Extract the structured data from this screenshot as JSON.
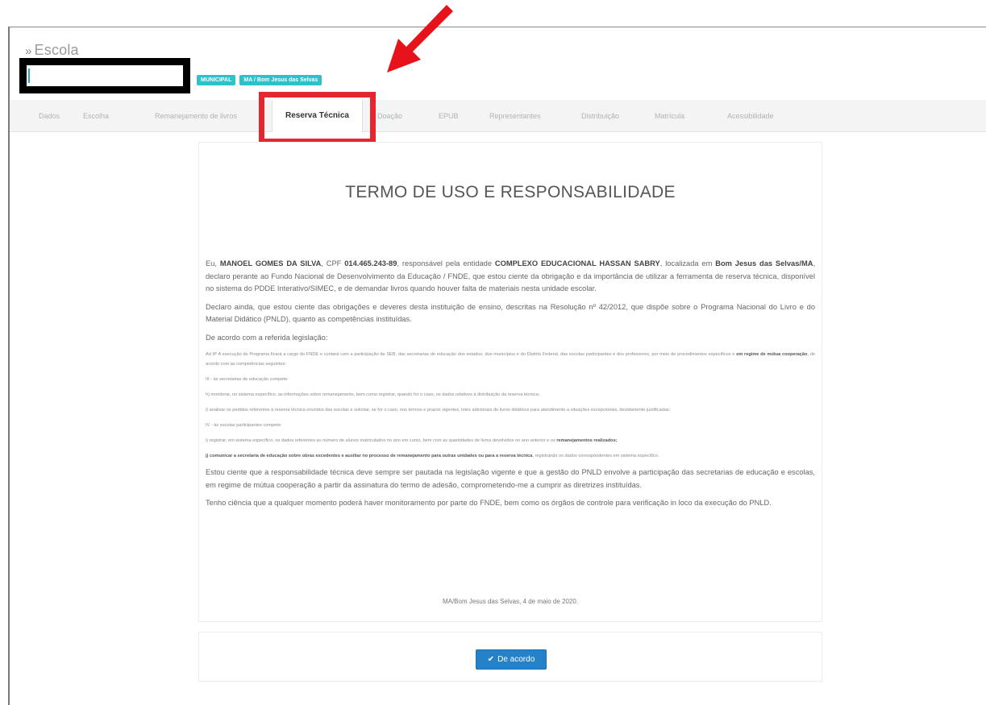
{
  "breadcrumb": {
    "icon": "double-chevron-right-icon",
    "glyph": "»",
    "label": "Escola"
  },
  "badges": [
    "MUNICIPAL",
    "MA / Bom Jesus das Selvas"
  ],
  "tabs": [
    {
      "label": "Dados",
      "active": false
    },
    {
      "label": "Escolha",
      "active": false
    },
    {
      "label": "Remanejamento de livros",
      "active": false
    },
    {
      "label": "Reserva Técnica",
      "active": true
    },
    {
      "label": "Doação",
      "active": false
    },
    {
      "label": "EPUB",
      "active": false
    },
    {
      "label": "Representantes",
      "active": false
    },
    {
      "label": "Distribuição",
      "active": false
    },
    {
      "label": "Matrícula",
      "active": false
    },
    {
      "label": "Acessibilidade",
      "active": false
    }
  ],
  "document": {
    "title": "TERMO DE USO E RESPONSABILIDADE",
    "p1": {
      "t1": "Eu, ",
      "name": "MANOEL GOMES DA SILVA",
      "t2": ", CPF ",
      "cpf": "014.465.243-89",
      "t3": ", responsável pela entidade ",
      "entity": "COMPLEXO EDUCACIONAL HASSAN SABRY",
      "t4": ", localizada em ",
      "location": "Bom Jesus das Selvas/MA",
      "t5": ", declaro perante ao Fundo Nacional de Desenvolvimento da Educação / FNDE, que estou ciente da obrigação e da importância de utilizar a ferramenta de reserva técnica, disponível no sistema do PDDE Interativo/SIMEC, e de demandar livros quando houver falta de materiais nesta unidade escolar."
    },
    "p2": "Declaro ainda, que estou ciente das obrigações e deveres desta instituição de ensino, descritas na Resolução nº 42/2012, que dispõe sobre o Programa Nacional do Livro e do Material Didático (PNLD), quanto as competências instituídas.",
    "p3": "De acordo com a referida legislação:",
    "s1": {
      "t1": "Art 8º A execução do Programa ficará a cargo do FNDE e contará com a participação da SEB, das secretarias de educação dos estados, dos municípios e do Distrito Federal, das escolas participantes e dos professores, por meio de procedimentos específicos e ",
      "bold": "em regime de mútua cooperação",
      "t2": ", de acordo com as competências seguintes:"
    },
    "s2": "III - às secretarias de educação compete:",
    "s3": "h) monitorar, no sistema específico, as informações sobre remanejamento, bem como registrar, quando for o caso, os dados relativos à distribuição da reserva técnica;",
    "s4": "i) analisar os pedidos referentes à reserva técnica oriundos das escolas e solicitar, se for o caso, nos termos e prazos vigentes, lotes adicionais de livros didáticos para atendimento a situações excepcionais, devidamente justificadas;",
    "s5": "IV - às escolas participantes compete:",
    "s6": {
      "t1": "i) registrar, em sistema específico, os dados referentes ao número de alunos matriculados no ano em curso, bem com as quantidades de livros devolvidos no ano anterior e os ",
      "bold": "remanejamentos realizados;"
    },
    "s7": {
      "bold": "j) comunicar a secretaria de educação sobre obras excedentes e auxiliar no processo de remanejamento para outras unidades ou para a reserva técnica",
      "t2": ", registrando os dados correspondentes em sistema específico."
    },
    "p4": "Estou ciente que a responsabilidade técnica deve sempre ser pautada na legislação vigente e que a gestão do PNLD envolve a participação das secretarias de educação e escolas, em regime de mútua cooperação a partir da assinatura do termo de adesão, comprometendo-me a cumprir as diretrizes instituídas.",
    "p5": "Tenho ciência que a qualquer momento poderá haver monitoramento por parte do FNDE, bem como os órgãos de controle para verificação in loco da execução do PNLD.",
    "signature": "MA/Bom Jesus das Selvas, 4 de maio de 2020."
  },
  "action": {
    "button_label": "De acordo",
    "button_icon": "check-icon",
    "accent": "#2582c8"
  },
  "annotations": {
    "arrow_color": "#e8121a",
    "highlight_color": "#e4262f"
  }
}
